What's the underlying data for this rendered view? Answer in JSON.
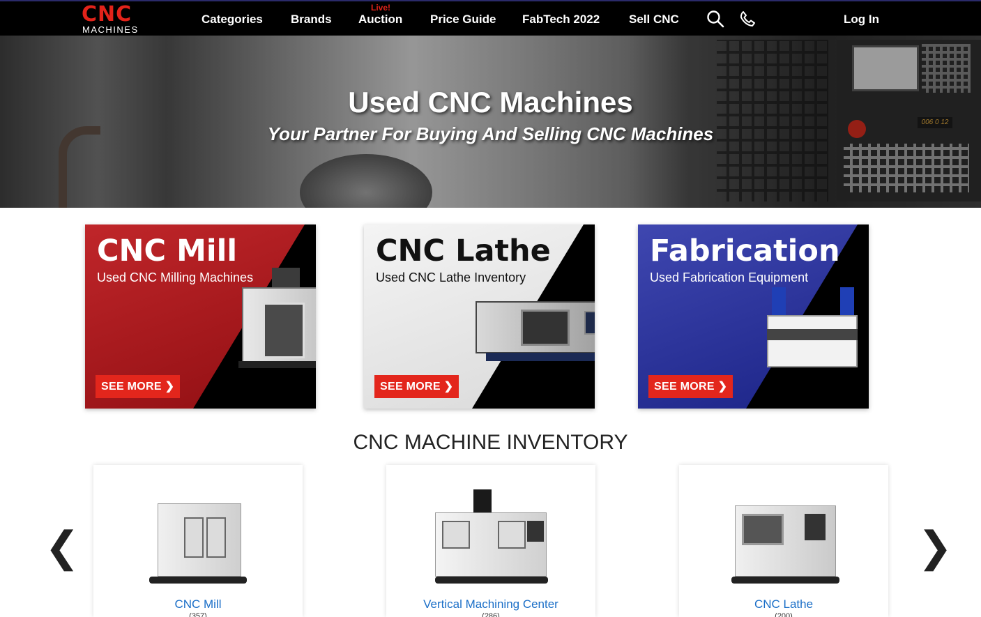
{
  "nav": {
    "logo_main": "CNC",
    "logo_sub": "MACHINES",
    "items": [
      "Categories",
      "Brands",
      "Auction",
      "Price Guide",
      "FabTech 2022",
      "Sell CNC"
    ],
    "live_badge": "Live!",
    "login": "Log In",
    "icons": [
      "search-icon",
      "phone-icon"
    ]
  },
  "hero": {
    "title": "Used CNC Machines",
    "subtitle": "Your Partner For Buying And Selling CNC Machines",
    "control_readout": "006 0 12"
  },
  "categories": [
    {
      "title": "CNC Mill",
      "subtitle": "Used CNC Milling Machines",
      "button": "SEE MORE ❯",
      "color": "#c0262a"
    },
    {
      "title": "CNC Lathe",
      "subtitle": "Used CNC Lathe Inventory",
      "button": "SEE MORE ❯",
      "color": "#f4f4f4"
    },
    {
      "title": "Fabrication",
      "subtitle": "Used Fabrication Equipment",
      "button": "SEE MORE ❯",
      "color": "#3f47b0"
    }
  ],
  "inventory": {
    "title": "CNC MACHINE INVENTORY",
    "prev": "❮",
    "next": "❯",
    "items": [
      {
        "name": "CNC Mill",
        "count": "(357)"
      },
      {
        "name": "Vertical Machining Center",
        "count": "(286)"
      },
      {
        "name": "CNC Lathe",
        "count": "(200)"
      }
    ]
  },
  "colors": {
    "accent": "#e2231a",
    "link": "#1a6ec7",
    "nav_bg": "#000000"
  }
}
